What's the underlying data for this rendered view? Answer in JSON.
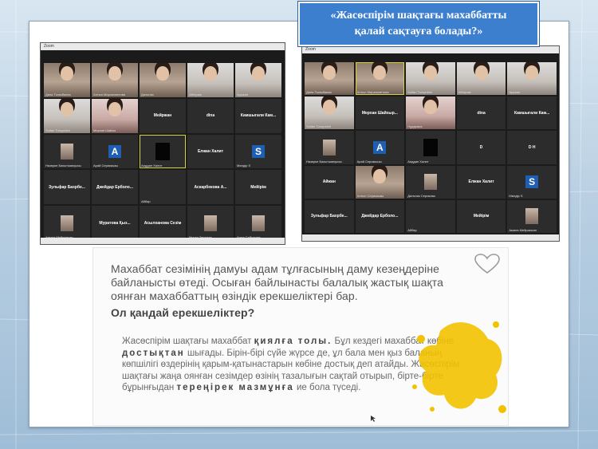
{
  "title": {
    "line1": "«Жасөспірім шақтағы махаббатты",
    "line2": "қалай сақтауға болады?»"
  },
  "zoom_left": {
    "window_label": "Zoom",
    "tiles": [
      {
        "name": "Дина Тыныбаева",
        "kind": "video"
      },
      {
        "name": "Алтын Мирзахметова",
        "kind": "video"
      },
      {
        "name": "Дильназ",
        "kind": "video"
      },
      {
        "name": "Айгерим",
        "kind": "video-light"
      },
      {
        "name": "Аружан",
        "kind": "video-light"
      },
      {
        "name": "Sultan Tursynbek",
        "kind": "video-light"
      },
      {
        "name": "Мерхан Шайхы",
        "kind": "video-pink"
      },
      {
        "name": "Мейржан",
        "kind": "text"
      },
      {
        "name": "dina",
        "kind": "text"
      },
      {
        "name": "Камшыгали Кам...",
        "kind": "text"
      },
      {
        "name": "Назерке Бахытжанқызы",
        "kind": "photo"
      },
      {
        "name": "Арай Сериккызы",
        "kind": "avatar",
        "letter": "A",
        "color": "#1e5fb3"
      },
      {
        "name": "Аиддан Халит",
        "kind": "black",
        "active": true
      },
      {
        "name": "Елжан Халит",
        "kind": "text"
      },
      {
        "name": "Мөлдір S",
        "kind": "avatar",
        "letter": "S",
        "color": "#1e5fb3"
      },
      {
        "name": "Зульфар Бахрбе...",
        "kind": "text"
      },
      {
        "name": "Джейдар Ерболо...",
        "kind": "text"
      },
      {
        "name": "Айбар",
        "kind": "empty"
      },
      {
        "name": "Аскарбекова А...",
        "kind": "text"
      },
      {
        "name": "Мейірім",
        "kind": "text"
      },
      {
        "name": "Аминa Мейрамхан",
        "kind": "photo"
      },
      {
        "name": "Муратова Қыз...",
        "kind": "text"
      },
      {
        "name": "Асылханова Сезім",
        "kind": "text"
      },
      {
        "name": "Мукан Зинаида",
        "kind": "photo"
      },
      {
        "name": "Аида Сабырова",
        "kind": "photo"
      }
    ]
  },
  "zoom_right": {
    "window_label": "Zoom",
    "tiles": [
      {
        "name": "Дина Тыныбаева",
        "kind": "video"
      },
      {
        "name": "Алтын Мирзахметова",
        "kind": "video",
        "active": true
      },
      {
        "name": "Sultan Tursynbek",
        "kind": "video-light"
      },
      {
        "name": "Айгерим",
        "kind": "video-light"
      },
      {
        "name": "Аружан",
        "kind": "video-light"
      },
      {
        "name": "Sultan Tursynbek",
        "kind": "video-light"
      },
      {
        "name": "Мерхан Шайхыр...",
        "kind": "text"
      },
      {
        "name": "Нұрдиана",
        "kind": "video-pink"
      },
      {
        "name": "dina",
        "kind": "text"
      },
      {
        "name": "Камшыгали Кам...",
        "kind": "text"
      },
      {
        "name": "Назерке Бахытжанқызы",
        "kind": "photo"
      },
      {
        "name": "Арай Сериккызы",
        "kind": "avatar",
        "letter": "A",
        "color": "#1e5fb3"
      },
      {
        "name": "Аиддан Халит",
        "kind": "black"
      },
      {
        "name": "D",
        "kind": "text"
      },
      {
        "name": "D H",
        "kind": "text"
      },
      {
        "name": "Айжан",
        "kind": "text"
      },
      {
        "name": "Алтын Сериккызы",
        "kind": "video"
      },
      {
        "name": "Дильназ Серикова",
        "kind": "photo"
      },
      {
        "name": "Елжан Халит",
        "kind": "text"
      },
      {
        "name": "Мөлдір S",
        "kind": "avatar",
        "letter": "S",
        "color": "#1e5fb3"
      },
      {
        "name": "Зульфар Бахрбе...",
        "kind": "text"
      },
      {
        "name": "Джейдар Ерболо...",
        "kind": "text"
      },
      {
        "name": "Айбар",
        "kind": "empty"
      },
      {
        "name": "Мейірім",
        "kind": "text"
      },
      {
        "name": "Аминa Мейрамхан",
        "kind": "photo"
      }
    ]
  },
  "text_card": {
    "paragraph1": "Махаббат сезімінің дамуы адам тұлғасының даму кезеңдеріне байланысты өтеді. Осыған байлынасты балалық жастық шақта оянған махаббаттың өзіндік ерекшеліктері бар.",
    "question": "Ол қандай ерекшеліктер?",
    "p2_part1": "Жасөспірім шақтағы махаббат ",
    "p2_bold1": "қиялға толы.",
    "p2_part2": " Бұл кездегі махаббат көбіне ",
    "p2_bold2": "достықтан",
    "p2_part3": " шығады. Бірін-бірі сүйе жүрсе де, ұл бала мен қыз баланың көпшілігі өздерінің қарым-қатынастарын көбіне достық деп атайды. Жасөспірім шақтағы жаңа оянған сезімдер өзінің тазалығын сақтай отырып, бірте-бірте бұрынғыдан ",
    "p2_bold3": "тереңірек мазмұнға",
    "p2_part4": " ие бола түседі."
  },
  "colors": {
    "title_bg": "#3d7fcf",
    "zoom_bg": "#1b1b1b",
    "splash": "#f2c200"
  }
}
